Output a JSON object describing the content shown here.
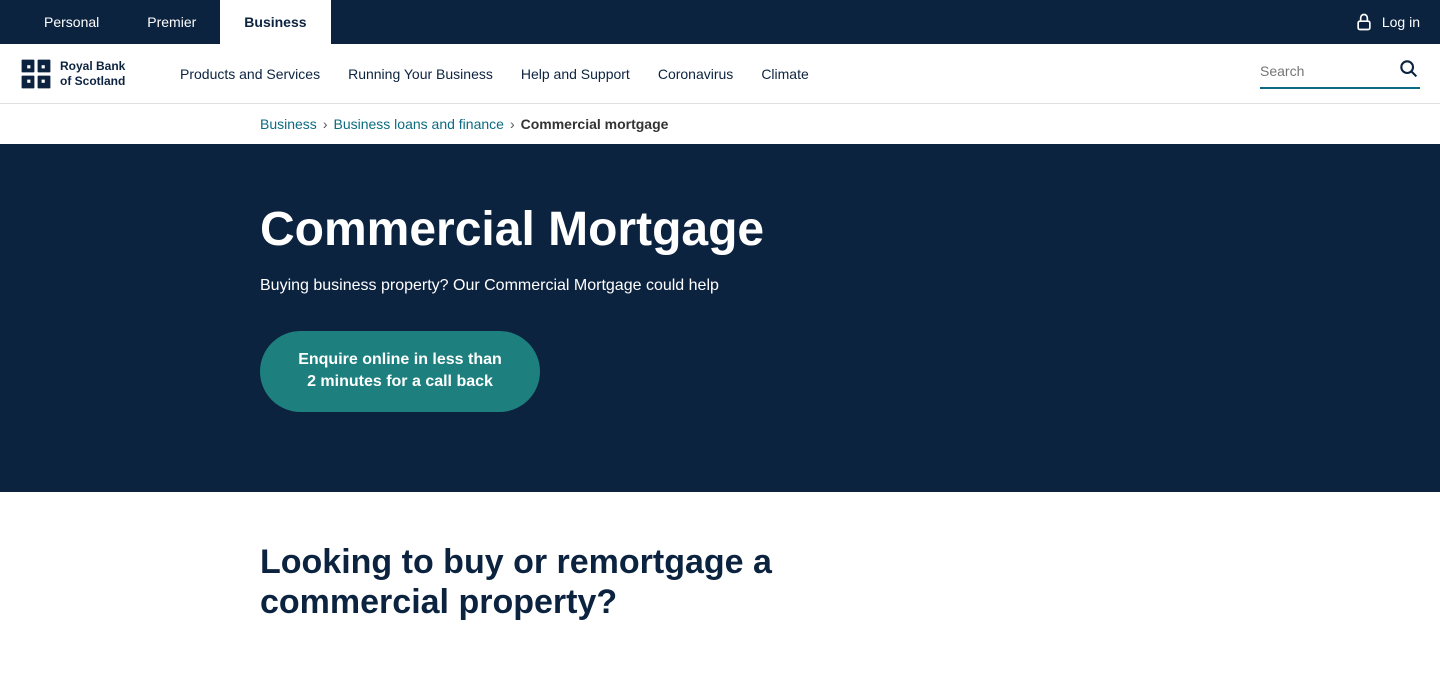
{
  "topBar": {
    "tabs": [
      {
        "label": "Personal",
        "active": false
      },
      {
        "label": "Premier",
        "active": false
      },
      {
        "label": "Business",
        "active": true
      }
    ],
    "login": {
      "label": "Log in"
    }
  },
  "secondaryNav": {
    "logo": {
      "line1": "Royal Bank",
      "line2": "of Scotland"
    },
    "links": [
      {
        "label": "Products and Services"
      },
      {
        "label": "Running Your Business"
      },
      {
        "label": "Help and Support"
      },
      {
        "label": "Coronavirus"
      },
      {
        "label": "Climate"
      }
    ],
    "search": {
      "placeholder": "Search",
      "label": "Search"
    }
  },
  "breadcrumb": {
    "items": [
      {
        "label": "Business",
        "link": true
      },
      {
        "label": "Business loans and finance",
        "link": true
      },
      {
        "label": "Commercial mortgage",
        "link": false
      }
    ]
  },
  "hero": {
    "title": "Commercial Mortgage",
    "subtitle": "Buying business property? Our Commercial Mortgage could help",
    "cta": "Enquire online in less than 2 minutes for a call back"
  },
  "belowHero": {
    "title": "Looking to buy or remortgage a commercial property?",
    "text": ""
  }
}
